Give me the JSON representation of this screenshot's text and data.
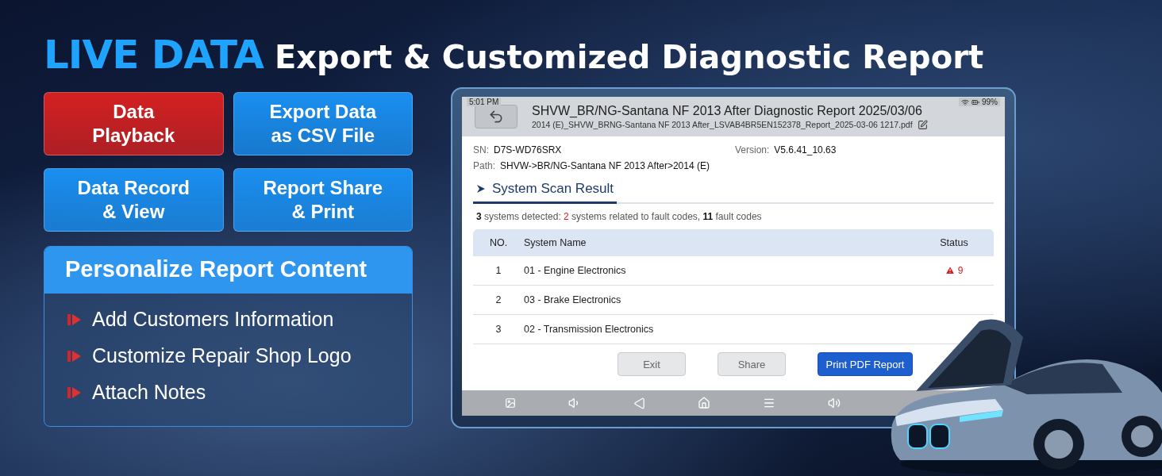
{
  "headline": {
    "highlight": "LIVE DATA",
    "rest": "Export & Customized Diagnostic Report"
  },
  "features": [
    {
      "label": "Data\nPlayback",
      "color": "#d42121"
    },
    {
      "label": "Export Data\nas CSV File",
      "color": "#1a8ff0"
    },
    {
      "label": "Data Record\n& View",
      "color": "#1a8ff0"
    },
    {
      "label": "Report Share\n& Print",
      "color": "#1a8ff0"
    }
  ],
  "personalize": {
    "title": "Personalize Report Content",
    "items": [
      "Add Customers Information",
      "Customize Repair Shop Logo",
      "Attach Notes"
    ]
  },
  "tablet": {
    "status": {
      "time": "5:01 PM",
      "battery": "99%"
    },
    "header": {
      "title": "SHVW_BR/NG-Santana NF 2013 After Diagnostic Report 2025/03/06",
      "file": "2014 (E)_SHVW_BRNG-Santana NF 2013 After_LSVAB4BR5EN152378_Report_2025-03-06 1217.pdf"
    },
    "info": [
      {
        "label": "SN:",
        "value": "D7S-WD76SRX"
      },
      {
        "label": "Version:",
        "value": "V5.6.41_10.63"
      },
      {
        "label": "Path:",
        "value": "SHVW->BR/NG-Santana NF 2013 After>2014 (E)"
      }
    ],
    "section": "System Scan Result",
    "summary": [
      {
        "text": "3",
        "kind": "strong"
      },
      {
        "text": " systems detected: ",
        "kind": "plain"
      },
      {
        "text": "2",
        "kind": "alert"
      },
      {
        "text": " systems related to fault codes, ",
        "kind": "plain"
      },
      {
        "text": "11",
        "kind": "strong"
      },
      {
        "text": " fault codes",
        "kind": "plain"
      }
    ],
    "table": {
      "columns": [
        "NO.",
        "System Name",
        "Status"
      ],
      "rows": [
        {
          "no": "1",
          "name": "01 - Engine Electronics",
          "fault": true,
          "status": "9"
        },
        {
          "no": "2",
          "name": "03 - Brake Electronics",
          "fault": false
        },
        {
          "no": "3",
          "name": "02 - Transmission Electronics",
          "fault": false
        }
      ]
    },
    "buttons": [
      {
        "label": "Exit",
        "kind": "secondary"
      },
      {
        "label": "Share",
        "kind": "secondary"
      },
      {
        "label": "Print PDF Report",
        "kind": "primary"
      }
    ]
  }
}
